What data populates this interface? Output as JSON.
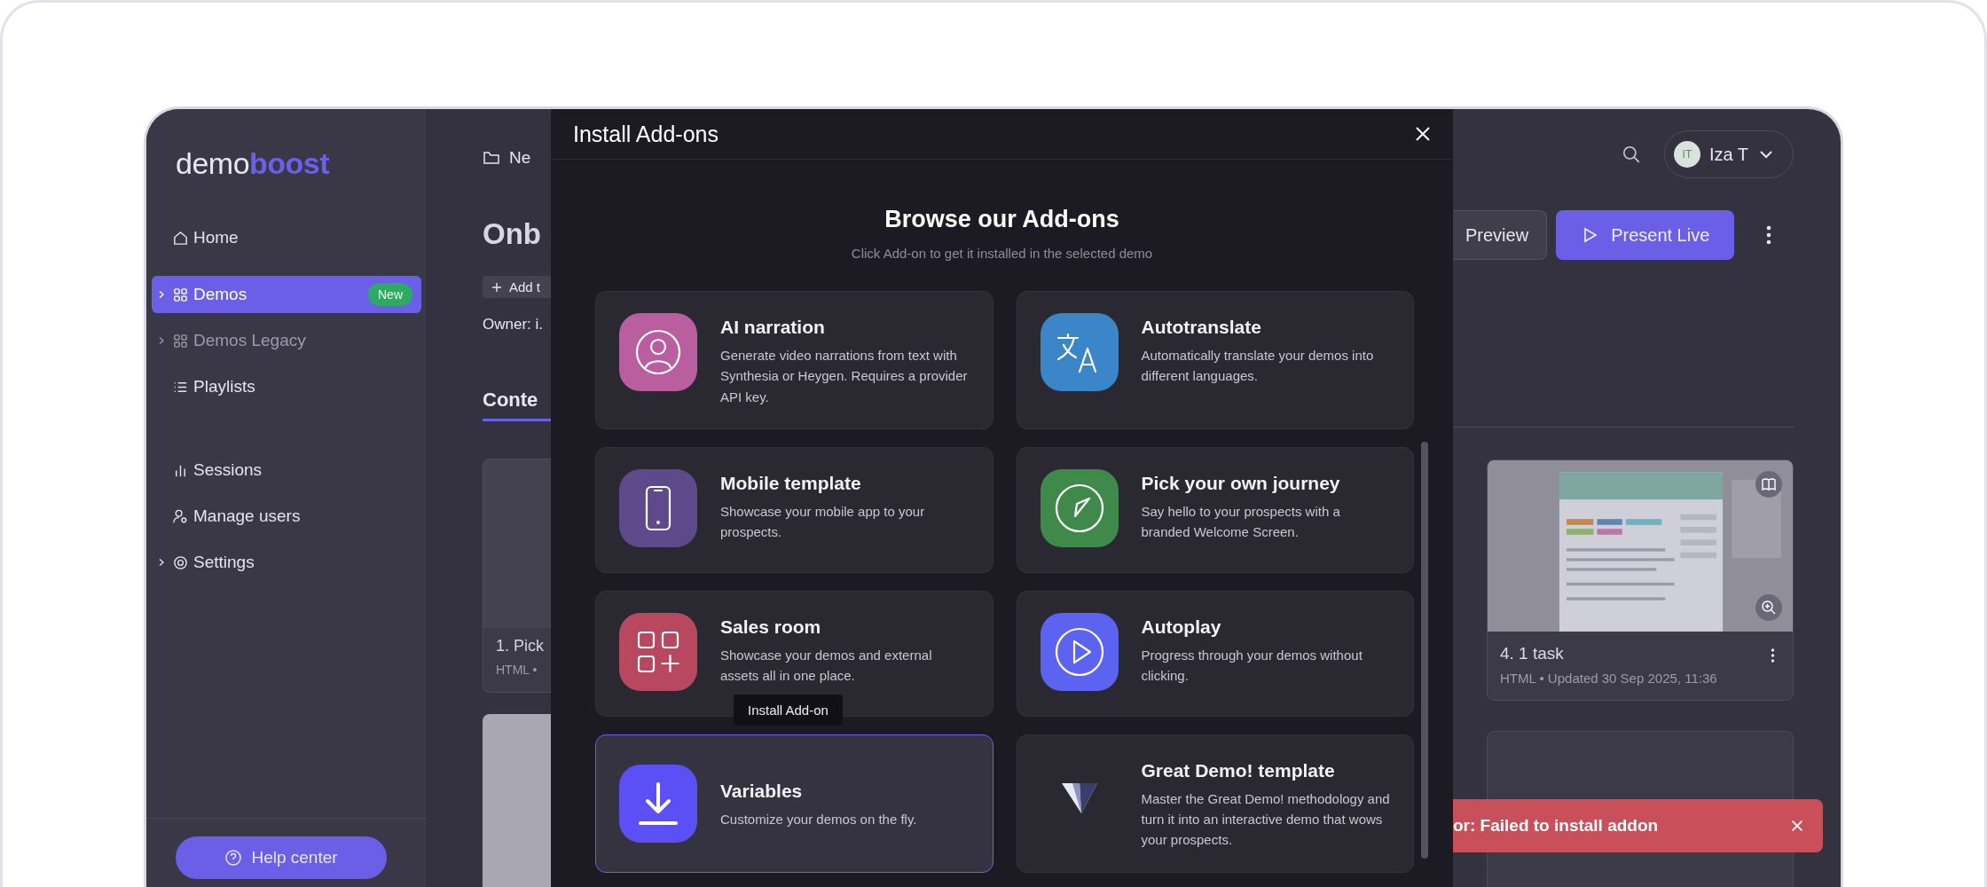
{
  "sidebar": {
    "logo": {
      "first": "demo",
      "second": "boost"
    },
    "items": [
      {
        "label": "Home",
        "selected": false,
        "expandable": false,
        "disabled": false
      },
      {
        "label": "Demos",
        "selected": true,
        "expandable": true,
        "disabled": false,
        "badge": "New"
      },
      {
        "label": "Demos Legacy",
        "selected": false,
        "expandable": true,
        "disabled": true
      },
      {
        "label": "Playlists",
        "selected": false,
        "expandable": false,
        "disabled": false
      },
      {
        "label": "Sessions",
        "selected": false,
        "expandable": false,
        "disabled": false
      },
      {
        "label": "Manage users",
        "selected": false,
        "expandable": false,
        "disabled": false
      },
      {
        "label": "Settings",
        "selected": false,
        "expandable": true,
        "disabled": false
      }
    ],
    "help_button": "Help center"
  },
  "page_left": {
    "breadcrumb": "Ne",
    "title": "Onb",
    "add_tag": "Add t",
    "owner": "Owner: i.",
    "tab": "Conte",
    "card": {
      "title": "1. Pick",
      "meta": "HTML •"
    }
  },
  "modal": {
    "title": "Install Add-ons",
    "heading": "Browse our Add-ons",
    "subtitle": "Click Add-on to get it installed in the selected demo",
    "addons": [
      {
        "title": "AI narration",
        "description": "Generate video narrations from text with Synthesia or Heygen. Requires a provider API key.",
        "color": "#b95e9f",
        "selected": false
      },
      {
        "title": "Autotranslate",
        "description": "Automatically translate your demos into different languages.",
        "color": "#3a86c8",
        "selected": false
      },
      {
        "title": "Mobile template",
        "description": "Showcase your mobile app to your prospects.",
        "color": "#5e4a8a",
        "selected": false
      },
      {
        "title": "Pick your own journey",
        "description": "Say hello to your prospects with a branded Welcome Screen.",
        "color": "#3f8a4a",
        "selected": false
      },
      {
        "title": "Sales room",
        "description": "Showcase your demos and external assets all in one place.",
        "color": "#b84860",
        "selected": false
      },
      {
        "title": "Autoplay",
        "description": "Progress through your demos without clicking.",
        "color": "#5b63f0",
        "selected": false
      },
      {
        "title": "Variables",
        "description": "Customize your demos on the fly.",
        "color": "#5a50f5",
        "selected": true,
        "tooltip": "Install Add-on"
      },
      {
        "title": "Great Demo! template",
        "description": "Master the Great Demo! methodology and turn it into an interactive demo that wows your prospects.",
        "selected": false
      }
    ]
  },
  "page_right": {
    "user": {
      "initials": "IT",
      "name": "Iza T"
    },
    "preview_button": "Preview",
    "present_button": "Present Live",
    "card": {
      "title": "4. 1 task",
      "meta": "HTML • Updated 30 Sep 2025, 11:36"
    },
    "toast": "or: Failed to install addon"
  }
}
